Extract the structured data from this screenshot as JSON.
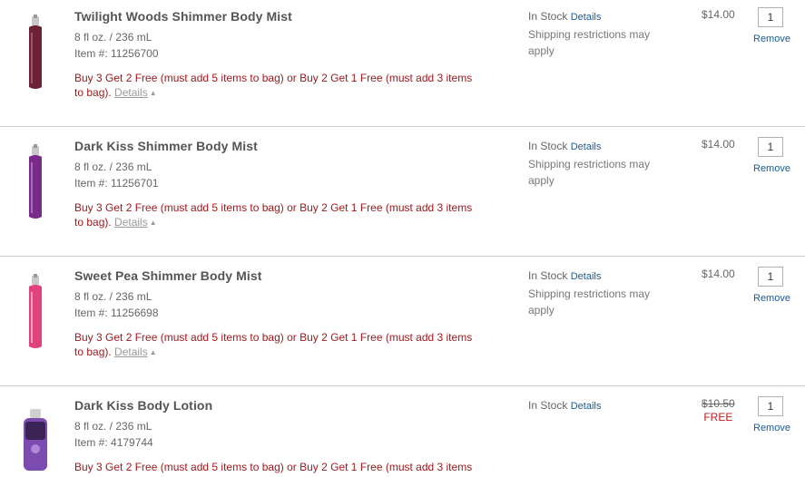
{
  "items": [
    {
      "title": "Twilight Woods Shimmer Body Mist",
      "size": "8 fl oz. / 236 mL",
      "item_no": "Item #: 11256700",
      "promo": "Buy 3 Get 2 Free (must add 5 items to bag) or Buy 2 Get 1 Free (must add 3 items to bag).",
      "promo_details": "Details",
      "stock": "In Stock",
      "stock_details": "Details",
      "shipping": "Shipping restrictions may apply",
      "price": "$14.00",
      "qty": "1",
      "remove": "Remove",
      "bottle_color": "#6e2035"
    },
    {
      "title": "Dark Kiss Shimmer Body Mist",
      "size": "8 fl oz. / 236 mL",
      "item_no": "Item #: 11256701",
      "promo": "Buy 3 Get 2 Free (must add 5 items to bag) or Buy 2 Get 1 Free (must add 3 items to bag).",
      "promo_details": "Details",
      "stock": "In Stock",
      "stock_details": "Details",
      "shipping": "Shipping restrictions may apply",
      "price": "$14.00",
      "qty": "1",
      "remove": "Remove",
      "bottle_color": "#7a2a8a"
    },
    {
      "title": "Sweet Pea Shimmer Body Mist",
      "size": "8 fl oz. / 236 mL",
      "item_no": "Item #: 11256698",
      "promo": "Buy 3 Get 2 Free (must add 5 items to bag) or Buy 2 Get 1 Free (must add 3 items to bag).",
      "promo_details": "Details",
      "stock": "In Stock",
      "stock_details": "Details",
      "shipping": "Shipping restrictions may apply",
      "price": "$14.00",
      "qty": "1",
      "remove": "Remove",
      "bottle_color": "#e0427e"
    },
    {
      "title": "Dark Kiss Body Lotion",
      "size": "8 fl oz. / 236 mL",
      "item_no": "Item #: 4179744",
      "promo": "Buy 3 Get 2 Free (must add 5 items to bag) or Buy 2 Get 1 Free (must add 3 items",
      "stock": "In Stock",
      "stock_details": "Details",
      "price_original": "$10.50",
      "price_free": "FREE",
      "qty": "1",
      "remove": "Remove",
      "bottle_color": "#7b4bb0"
    }
  ]
}
